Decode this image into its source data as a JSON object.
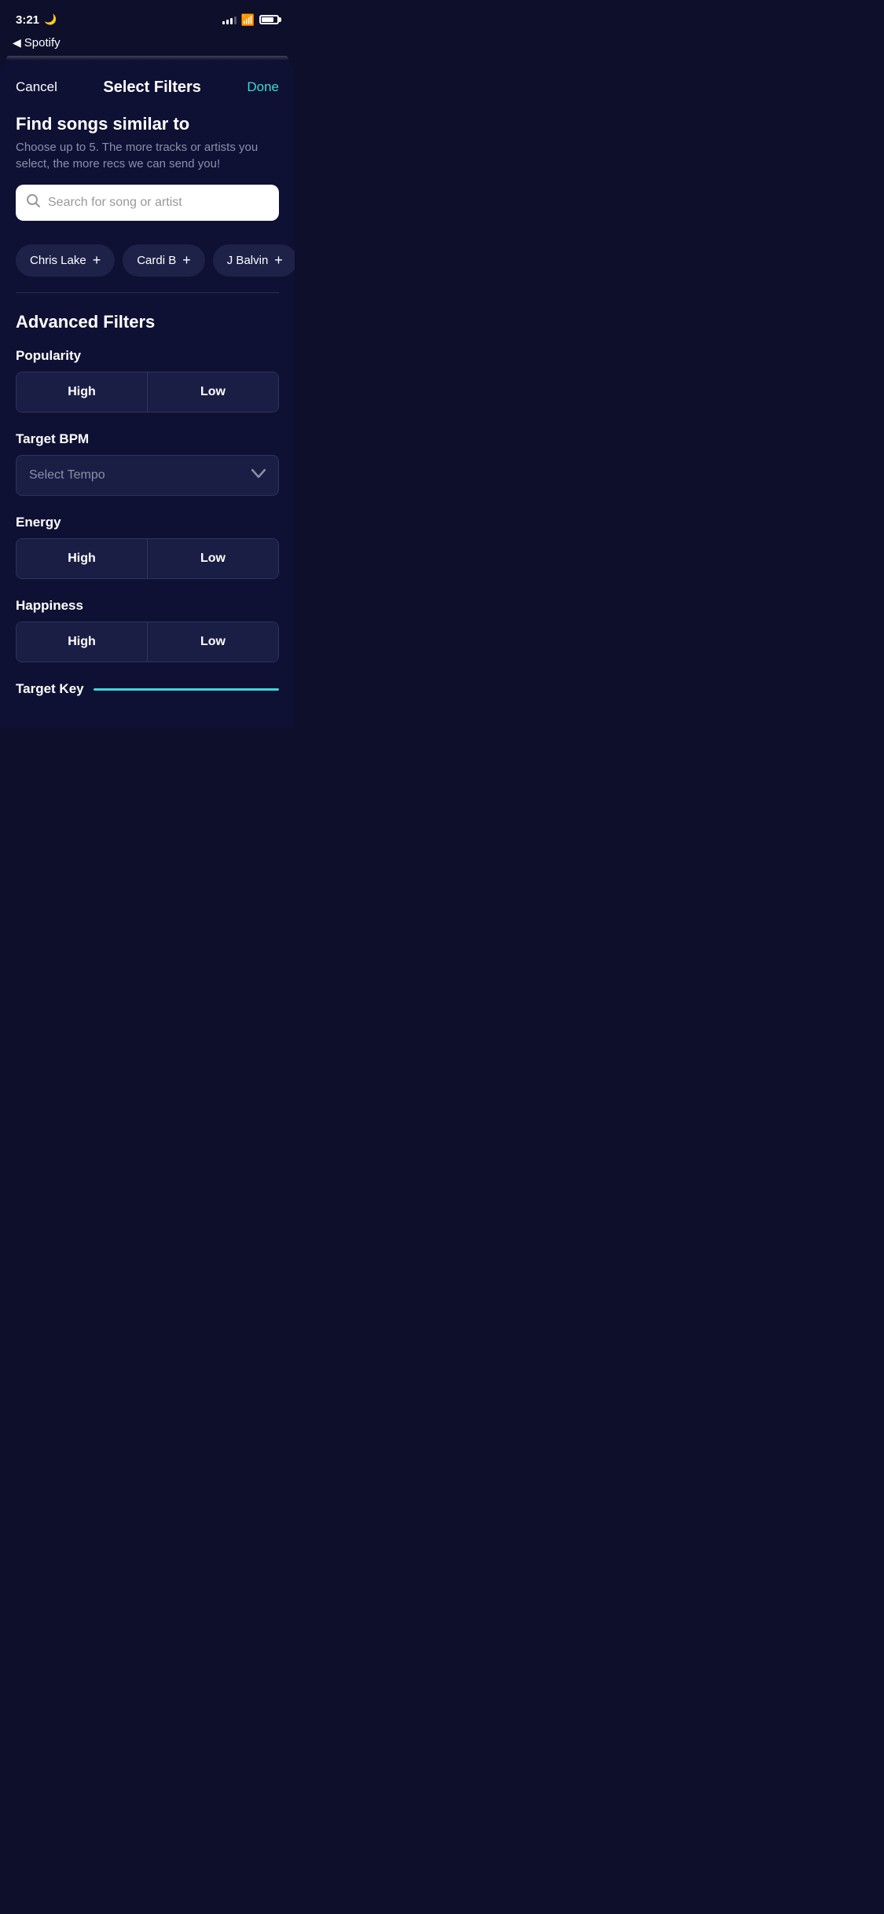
{
  "statusBar": {
    "time": "3:21",
    "moonIcon": "🌙"
  },
  "backNav": {
    "arrow": "◀",
    "label": "Spotify"
  },
  "header": {
    "cancelLabel": "Cancel",
    "title": "Select Filters",
    "doneLabel": "Done"
  },
  "findSection": {
    "title": "Find songs similar to",
    "subtitle": "Choose up to 5. The more tracks or artists you select, the more recs we can send you!",
    "searchPlaceholder": "Search for song or artist"
  },
  "chips": [
    {
      "label": "Chris Lake",
      "plus": "+"
    },
    {
      "label": "Cardi B",
      "plus": "+"
    },
    {
      "label": "J Balvin",
      "plus": "+"
    }
  ],
  "advancedFilters": {
    "title": "Advanced Filters",
    "filters": [
      {
        "id": "popularity",
        "label": "Popularity",
        "type": "toggle",
        "options": [
          "High",
          "Low"
        ]
      },
      {
        "id": "targetBpm",
        "label": "Target BPM",
        "type": "dropdown",
        "placeholder": "Select Tempo"
      },
      {
        "id": "energy",
        "label": "Energy",
        "type": "toggle",
        "options": [
          "High",
          "Low"
        ]
      },
      {
        "id": "happiness",
        "label": "Happiness",
        "type": "toggle",
        "options": [
          "High",
          "Low"
        ]
      }
    ],
    "targetKey": {
      "label": "Target Key"
    }
  },
  "icons": {
    "search": "🔍",
    "chevronDown": "⌄"
  }
}
